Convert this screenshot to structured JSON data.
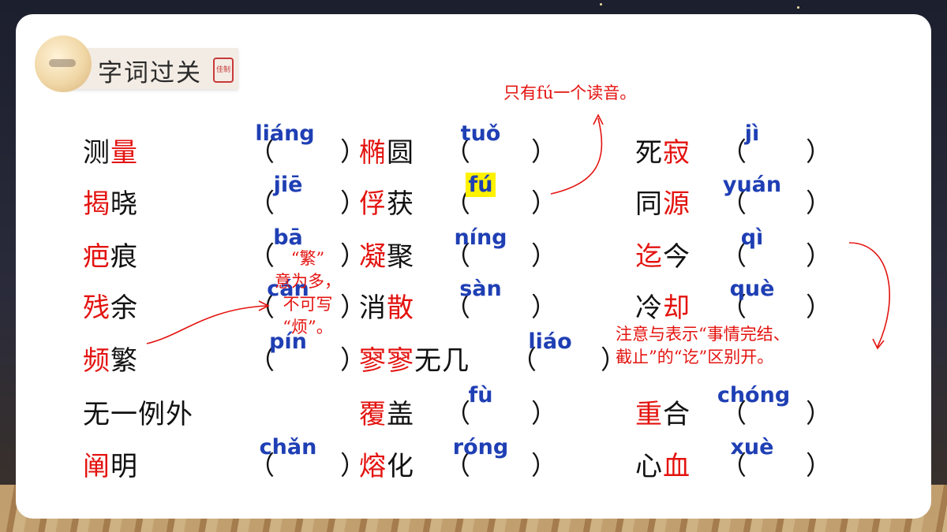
{
  "title": "字词过关",
  "seal_text": "佳制",
  "entries": [
    {
      "chars": [
        {
          "t": "测",
          "h": false
        },
        {
          "t": "量",
          "h": true
        }
      ],
      "pinyin": "liáng"
    },
    {
      "chars": [
        {
          "t": "揭",
          "h": true
        },
        {
          "t": "晓",
          "h": false
        }
      ],
      "pinyin": "jiē"
    },
    {
      "chars": [
        {
          "t": "疤",
          "h": true
        },
        {
          "t": "痕",
          "h": false
        }
      ],
      "pinyin": "bā"
    },
    {
      "chars": [
        {
          "t": "残",
          "h": true
        },
        {
          "t": "余",
          "h": false
        }
      ],
      "pinyin": "cán"
    },
    {
      "chars": [
        {
          "t": "频",
          "h": true
        },
        {
          "t": "繁",
          "h": false
        }
      ],
      "pinyin": "pín"
    },
    {
      "chars": [
        {
          "t": "无一例外",
          "h": false
        }
      ],
      "pinyin": ""
    },
    {
      "chars": [
        {
          "t": "阐",
          "h": true
        },
        {
          "t": "明",
          "h": false
        }
      ],
      "pinyin": "chǎn"
    },
    {
      "chars": [
        {
          "t": "椭",
          "h": true
        },
        {
          "t": "圆",
          "h": false
        }
      ],
      "pinyin": "tuǒ"
    },
    {
      "chars": [
        {
          "t": "俘",
          "h": true
        },
        {
          "t": "获",
          "h": false
        }
      ],
      "pinyin": "fú"
    },
    {
      "chars": [
        {
          "t": "凝",
          "h": true
        },
        {
          "t": "聚",
          "h": false
        }
      ],
      "pinyin": "níng"
    },
    {
      "chars": [
        {
          "t": "消",
          "h": false
        },
        {
          "t": "散",
          "h": true
        }
      ],
      "pinyin": "sàn"
    },
    {
      "chars": [
        {
          "t": "寥寥",
          "h": true
        },
        {
          "t": "无几",
          "h": false
        }
      ],
      "pinyin": "liáo"
    },
    {
      "chars": [
        {
          "t": "覆",
          "h": true
        },
        {
          "t": "盖",
          "h": false
        }
      ],
      "pinyin": "fù"
    },
    {
      "chars": [
        {
          "t": "熔",
          "h": true
        },
        {
          "t": "化",
          "h": false
        }
      ],
      "pinyin": "róng"
    },
    {
      "chars": [
        {
          "t": "死",
          "h": false
        },
        {
          "t": "寂",
          "h": true
        }
      ],
      "pinyin": "jì"
    },
    {
      "chars": [
        {
          "t": "同",
          "h": false
        },
        {
          "t": "源",
          "h": true
        }
      ],
      "pinyin": "yuán"
    },
    {
      "chars": [
        {
          "t": "迄",
          "h": true
        },
        {
          "t": "今",
          "h": false
        }
      ],
      "pinyin": "qì"
    },
    {
      "chars": [
        {
          "t": "冷",
          "h": false
        },
        {
          "t": "却",
          "h": true
        }
      ],
      "pinyin": "què"
    },
    {
      "chars": [
        {
          "t": "重",
          "h": true
        },
        {
          "t": "合",
          "h": false
        }
      ],
      "pinyin": "chóng"
    },
    {
      "chars": [
        {
          "t": "心",
          "h": false
        },
        {
          "t": "血",
          "h": true
        }
      ],
      "pinyin": "xuè"
    }
  ],
  "paren_open": "（",
  "paren_close": "）",
  "notes": {
    "fu": "只有fú一个读音。",
    "fan": [
      "“繁”",
      "意为多，",
      "不可写",
      "“烦”。"
    ],
    "qi": [
      "注意与表示“事情完结、",
      "截止”的“讫”区别开。"
    ]
  },
  "colors": {
    "highlight": "#e3130f",
    "pinyin": "#1f3fb4",
    "marker": "#fff200"
  }
}
